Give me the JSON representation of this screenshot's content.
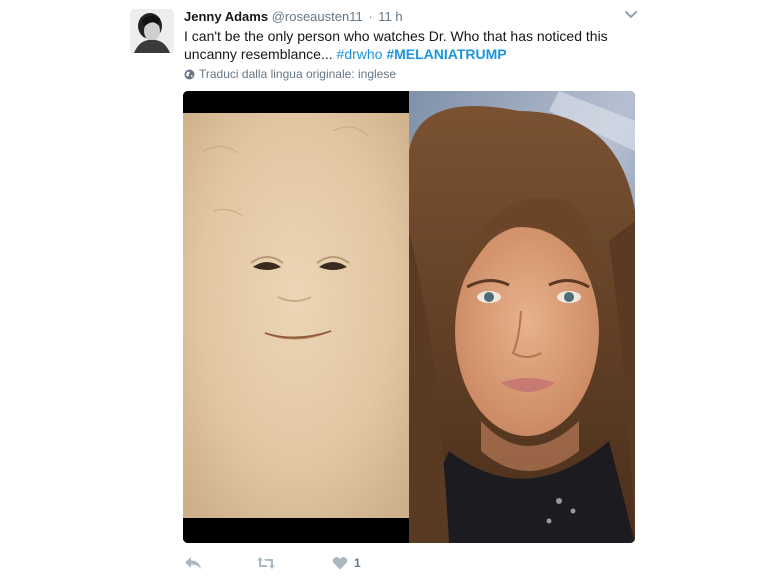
{
  "tweet": {
    "name": "Jenny Adams",
    "handle": "@roseausten11",
    "separator": "·",
    "time": "11 h",
    "text_plain": "I can't be the only person who watches Dr. Who that has noticed this uncanny resemblance...",
    "hashtag1": "#drwho",
    "hashtag2": "#MELANIATRUMP",
    "translate_label": "Traduci dalla lingua originale: inglese",
    "like_count": "1"
  },
  "icons": {
    "caret": "chevron-down-icon",
    "translate": "globe-icon",
    "reply": "reply-icon",
    "retweet": "retweet-icon",
    "like": "heart-icon"
  },
  "colors": {
    "link": "#1b95e0",
    "muted": "#657786",
    "text": "#14171a"
  }
}
